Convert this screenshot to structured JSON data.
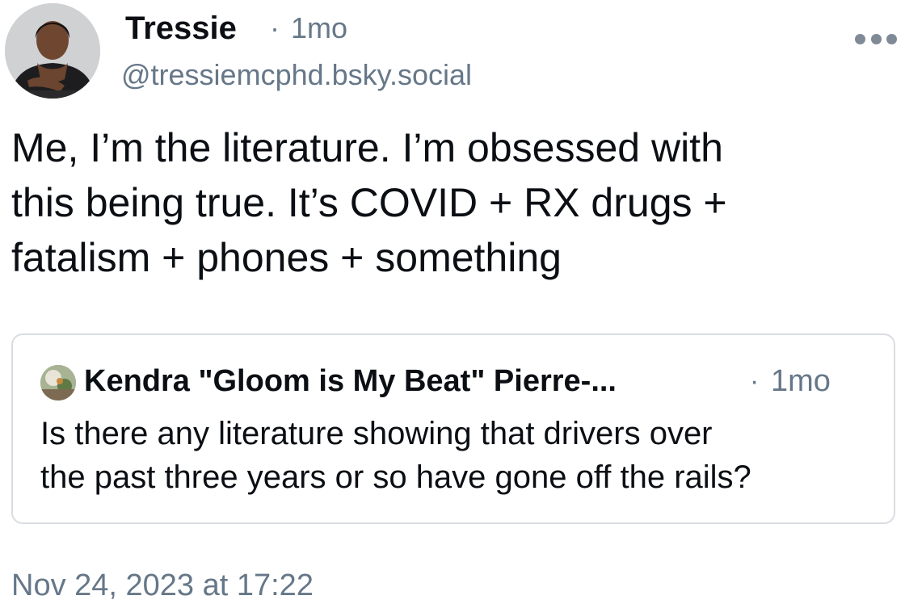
{
  "post": {
    "author": {
      "display_name": "Tressie",
      "handle": "@tressiemcphd.bsky.social",
      "avatar_icon": "profile-photo"
    },
    "separator": "·",
    "relative_time": "1mo",
    "more_icon": "ellipsis-icon",
    "text_lines": [
      "Me, I’m the literature. I’m obsessed with",
      "this being true. It’s COVID + RX drugs +",
      "fatalism + phones + something"
    ],
    "timestamp": "Nov 24, 2023 at 17:22"
  },
  "quote": {
    "author": "Kendra \"Gloom is My Beat\" Pierre-...",
    "avatar_icon": "profile-photo",
    "separator": "·",
    "relative_time": "1mo",
    "text_lines": [
      "Is there any literature showing that drivers over",
      "the past three years or so have gone off the rails?"
    ]
  },
  "colors": {
    "text": "#0b0f14",
    "secondary_text": "#667788",
    "border": "#d9dde2",
    "more_dots": "#7f8a96"
  }
}
